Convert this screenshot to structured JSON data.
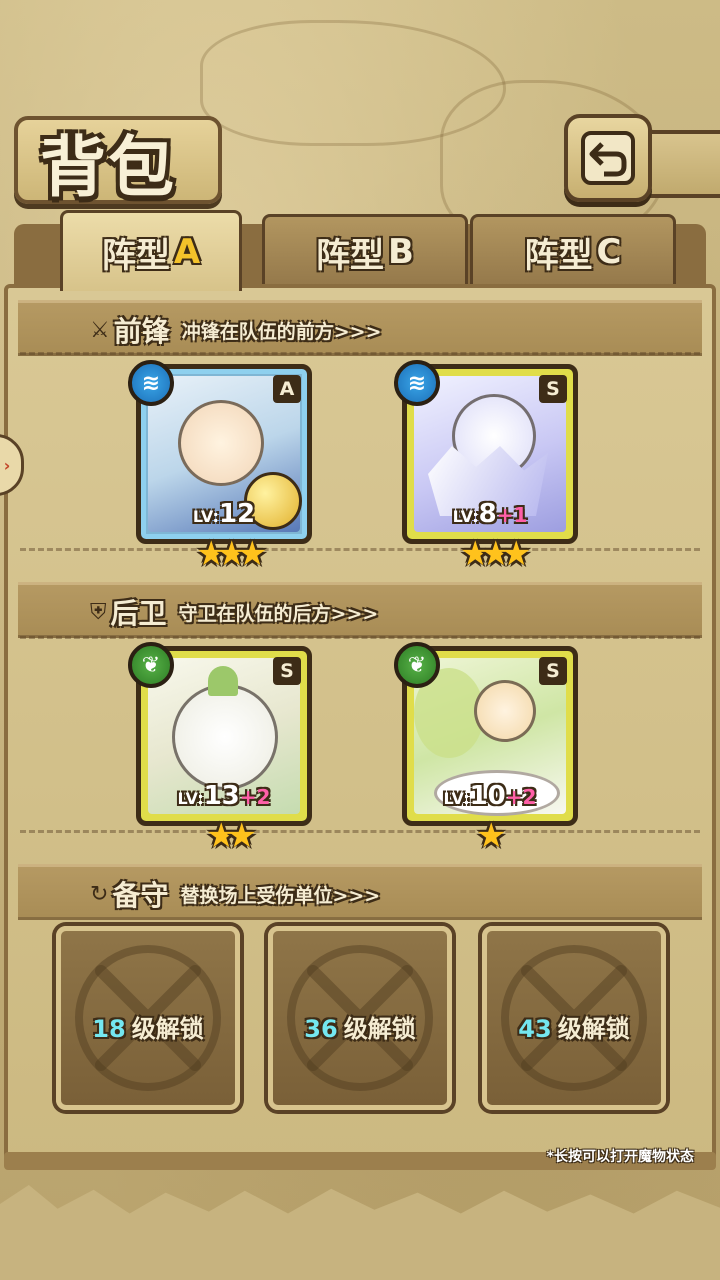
{
  "header": {
    "title": "背包"
  },
  "tabs": [
    {
      "label": "阵型",
      "letter": "A",
      "active": true
    },
    {
      "label": "阵型",
      "letter": "B",
      "active": false
    },
    {
      "label": "阵型",
      "letter": "C",
      "active": false
    }
  ],
  "sections": {
    "front": {
      "name": "前锋",
      "desc": "冲锋在队伍的前方>>>"
    },
    "back": {
      "name": "后卫",
      "desc": "守卫在队伍的后方>>>"
    },
    "reserve": {
      "name": "备守",
      "desc": "替换场上受伤单位>>>"
    }
  },
  "units": [
    {
      "rank": "A",
      "lv_prefix": "LV:",
      "level": "12",
      "bonus": "",
      "stars": 3,
      "element": "water"
    },
    {
      "rank": "S",
      "lv_prefix": "LV:",
      "level": "8",
      "bonus": "+1",
      "stars": 3,
      "element": "water"
    },
    {
      "rank": "S",
      "lv_prefix": "LV:",
      "level": "13",
      "bonus": "+2",
      "stars": 2,
      "element": "wood"
    },
    {
      "rank": "S",
      "lv_prefix": "LV:",
      "level": "10",
      "bonus": "+2",
      "stars": 1,
      "element": "wood"
    }
  ],
  "slots": [
    {
      "level": "18",
      "text": "级解锁"
    },
    {
      "level": "36",
      "text": "级解锁"
    },
    {
      "level": "43",
      "text": "级解锁"
    }
  ],
  "note": "*长按可以打开魔物状态",
  "colors": {
    "water": "#1c6fb8",
    "wood": "#2e7d25",
    "star": "#ffc21c",
    "bonus": "#ff5fa8",
    "unlock_level": "#74e7f0"
  },
  "icons": {
    "back": "return-arrow-icon",
    "water": "wave-icon",
    "wood": "leaf-icon",
    "front": "sword-icon",
    "back_section": "shield-icon",
    "reserve": "cycle-icon",
    "lock": "locked-x-icon"
  }
}
